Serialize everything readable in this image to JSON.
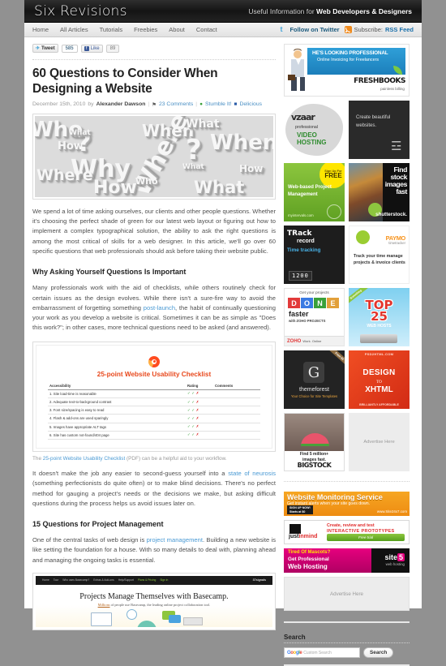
{
  "site": {
    "logo": "Six Revisions",
    "tagline_plain": "Useful Information for ",
    "tagline_bold": "Web Developers & Designers"
  },
  "nav": {
    "items": [
      {
        "label": "Home"
      },
      {
        "label": "All Articles"
      },
      {
        "label": "Tutorials"
      },
      {
        "label": "Freebies"
      },
      {
        "label": "About"
      },
      {
        "label": "Contact"
      }
    ],
    "twitter": "Follow on Twitter",
    "subscribe_label": "Subscribe:",
    "subscribe_link": "RSS Feed"
  },
  "share": {
    "tweet_label": "Tweet",
    "tweet_count": "585",
    "like_label": "Like",
    "like_count": "89"
  },
  "article": {
    "title": "60 Questions to Consider When Designing a Website",
    "date": "December 15th, 2010",
    "by": "by",
    "author": "Alexander Dawson",
    "comments": "23 Comments",
    "stumble": "Stumble It!",
    "delicious": "Delicious",
    "featured_words": [
      "Who",
      "How",
      "Why",
      "Where",
      "What",
      "When",
      "?"
    ],
    "paragraphs": {
      "p1": "We spend a lot of time asking ourselves, our clients and other people questions. Whether it's choosing the perfect shade of green for our latest web layout or figuring out how to implement a complex typographical solution, the ability to ask the right questions is among the most critical of skills for a web designer. In this article, we'll go over 60 specific questions that web professionals should ask before taking their website public.",
      "h2_1": "Why Asking Yourself Questions Is Important",
      "p2_a": "Many professionals work with the aid of checklists, while others routinely check for certain issues as the design evolves. While there isn't a sure-fire way to avoid the embarrassment of forgetting something ",
      "p2_link": "post-launch",
      "p2_b": ", the habit of continually questioning your work as you develop a website is critical. Sometimes it can be as simple as \"Does this work?\"; in other cases, more technical questions need to be asked (and answered).",
      "cap_a": "The ",
      "cap_link": "25-point Website Usability Checklist",
      "cap_b": " (PDF) can be a helpful aid to your workflow.",
      "p3_a": "It doesn't make the job any easier to second-guess yourself into a ",
      "p3_link": "state of neurosis",
      "p3_b": " (something perfectionists do quite often) or to make blind decisions. There's no perfect method for gauging a project's needs or the decisions we make, but asking difficult questions during the process helps us avoid issues later on.",
      "h2_2": "15 Questions for Project Management",
      "p4_a": "One of the central tasks of web design is ",
      "p4_link": "project management",
      "p4_b": ". Building a new website is like setting the foundation for a house. With so many details to deal with, planning ahead and managing the ongoing tasks is essential."
    }
  },
  "checklist": {
    "title": "25-point Website Usability Checklist",
    "columns": [
      "Accessibility",
      "Rating",
      "Comments"
    ],
    "rows": [
      "1. Site load-time is reasonable",
      "2. Adequate text-to-background contrast",
      "3. Font size/spacing is easy to read",
      "4. Flash & add-ons are used sparingly",
      "5. Images have appropriate ALT tags",
      "6. Site has custom not-found/404 page"
    ]
  },
  "basecamp": {
    "nav": [
      "Home",
      "Tour",
      "Who uses Basecamp?",
      "Extras & Add-ons",
      "Help/Support"
    ],
    "nav_green": [
      "Plans & Pricing",
      "Sign in"
    ],
    "brand": "37signals",
    "headline": "Projects Manage Themselves with Basecamp.",
    "sub_link": "Millions",
    "sub_rest": " of people use Basecamp, the leading online project collaboration tool."
  },
  "sidebar": {
    "ads": {
      "freshbooks": {
        "line1": "HE'S LOOKING PROFESSIONAL",
        "line2": "Online Invoicing for Freelancers",
        "logo_a": "FRESH",
        "logo_b": "BOOKS",
        "sub": "painless billing"
      },
      "vzaar": {
        "logo": "vzaar",
        "pro": "professional",
        "l1": "VIDEO",
        "l2": "HOSTING"
      },
      "squarespace": {
        "text": "Create beautiful websites."
      },
      "intervals": {
        "badge1": "Sign Up For",
        "badge2": "FREE",
        "text": "Web-based Project Management",
        "url": "myintervals.com"
      },
      "shutterstock": {
        "l1": "Find",
        "l2": "stock",
        "l3": "images",
        "l4": "fast",
        "brand": "shutterstock."
      },
      "trackrecord": {
        "t1": "TRack",
        "t2": "record",
        "sub": "Time tracking",
        "digits": "1200"
      },
      "paymo": {
        "logo": "PAYMO",
        "logo_sub": "timetracker",
        "text": "Track your time manage projects & invoice clients"
      },
      "zoho": {
        "top": "Get your projects",
        "done": "DONE",
        "faster": "faster",
        "with": "with ZOHO PROJECTS",
        "brand": "ZOHO",
        "tag": "Work. Online"
      },
      "top25": {
        "ribbon": "Something",
        "t1": "TOP",
        "t2": "25",
        "sub": "WEB HOSTS"
      },
      "themeforest": {
        "ribbon": "From $5",
        "name": "themeforest",
        "sub": "Your Choice for Site Templates"
      },
      "psd2html": {
        "top": "PSD2HTML.COM",
        "d": "DESIGN",
        "to": "TO",
        "x": "XHTML",
        "bottom": "BRILLIANTLY AFFORDABLE"
      },
      "bigstock": {
        "t1": "Find 5 million+",
        "t2": "images fast.",
        "logo": "BIGSTOCK"
      },
      "advertise": "Advertise Here",
      "site24x7": {
        "head": "Website Monitoring Service",
        "sub": "Get instant alerts when your site goes down.",
        "btn1": "SIGN UP NOW!",
        "btn2": "Starts at $0",
        "url": "www.Site24x7.com"
      },
      "justinmind": {
        "logo_a": "just",
        "logo_b": "inmind",
        "r1": "Create, review and test",
        "r2": "INTERACTIVE  PROTOTYPES",
        "cta": "Free trial"
      },
      "site5": {
        "l1": "Tired Of Mascots?",
        "l2": "Get Professional",
        "l3": "Web Hosting",
        "brand": "site",
        "brand_num": "5",
        "brand_sub": "web hosting"
      },
      "advertise_wide": "Advertise Here"
    },
    "search": {
      "heading": "Search",
      "placeholder": "Custom Search",
      "google": [
        "G",
        "o",
        "o",
        "g",
        "l",
        "e"
      ],
      "button": "Search"
    }
  }
}
